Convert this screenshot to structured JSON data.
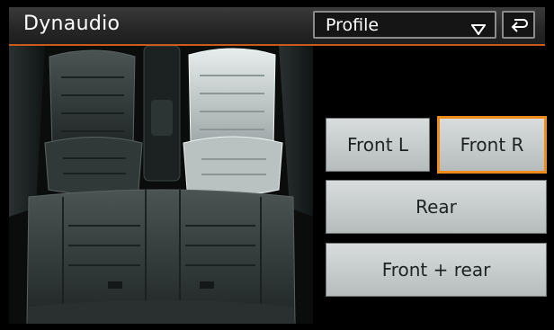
{
  "header": {
    "title": "Dynaudio",
    "profile_dropdown": {
      "selected": "Profile",
      "icon": "triangle-down-icon"
    },
    "back_icon": "back-arrow-icon"
  },
  "seat_view": {
    "selected_seat": "Front R",
    "highlight_color": "#cfd6d6",
    "seat_color": "#2e3434"
  },
  "fader_buttons": [
    {
      "label": "Front L",
      "selected": false
    },
    {
      "label": "Front R",
      "selected": true
    },
    {
      "label": "Rear",
      "selected": false
    },
    {
      "label": "Front + rear",
      "selected": false
    }
  ],
  "colors": {
    "accent_line": "#c85a1a",
    "selection_outline": "#f08c1e",
    "button_face": "#c8cdcd"
  }
}
